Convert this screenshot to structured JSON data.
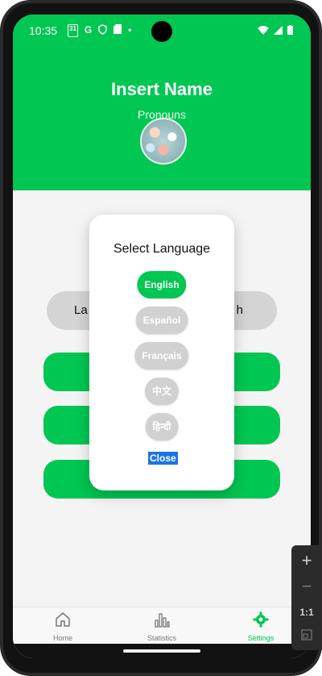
{
  "status_bar": {
    "time": "10:35",
    "icons": [
      "31",
      "G",
      "shield-icon",
      "sd-card-icon",
      "dot"
    ]
  },
  "header": {
    "title": "Insert Name",
    "pronouns": "Pronouns"
  },
  "background": {
    "language_label": "La",
    "language_value": "h"
  },
  "modal": {
    "title": "Select Language",
    "options": [
      "English",
      "Español",
      "Français",
      "中文",
      "हिन्दी"
    ],
    "selected": "English",
    "close_label": "Close"
  },
  "bottom_nav": [
    {
      "label": "Home",
      "icon": "home-icon",
      "active": false
    },
    {
      "label": "Statistics",
      "icon": "bar-chart-icon",
      "active": false
    },
    {
      "label": "Settings",
      "icon": "gear-icon",
      "active": true
    }
  ],
  "emulator": {
    "ratio_label": "1:1"
  },
  "colors": {
    "accent": "#00c652",
    "option_bg": "#d1d1d1",
    "close_highlight": "#1a73e8"
  }
}
